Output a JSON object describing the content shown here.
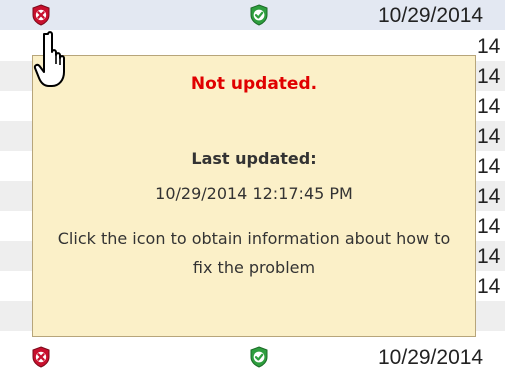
{
  "rows": [
    {
      "status": "error",
      "check": "ok",
      "date": "10/29/2014"
    },
    {
      "status": "error",
      "check": "ok",
      "date": "14"
    },
    {
      "status": "error",
      "check": "ok",
      "date": "14"
    },
    {
      "status": "error",
      "check": "ok",
      "date": "14"
    },
    {
      "status": "error",
      "check": "ok",
      "date": "14"
    },
    {
      "status": "error",
      "check": "ok",
      "date": "14"
    },
    {
      "status": "error",
      "check": "ok",
      "date": "14"
    },
    {
      "status": "error",
      "check": "ok",
      "date": "14"
    },
    {
      "status": "error",
      "check": "ok",
      "date": "14"
    },
    {
      "status": "error",
      "check": "ok",
      "date": "14"
    },
    {
      "status": "error",
      "check": "ok",
      "date": "10/29/2014"
    }
  ],
  "tooltip": {
    "title": "Not updated.",
    "last_updated_label": "Last updated:",
    "last_updated_value": "10/29/2014 12:17:45 PM",
    "message": "Click the icon to obtain information about how to fix the problem"
  },
  "colors": {
    "error": "#c8102e",
    "ok": "#2e9e3e",
    "tooltip_bg": "#fbf0c8",
    "title": "#e00000"
  },
  "icons": {
    "status": "error-shield-icon",
    "check": "ok-shield-icon",
    "cursor": "hand-pointer-icon"
  }
}
